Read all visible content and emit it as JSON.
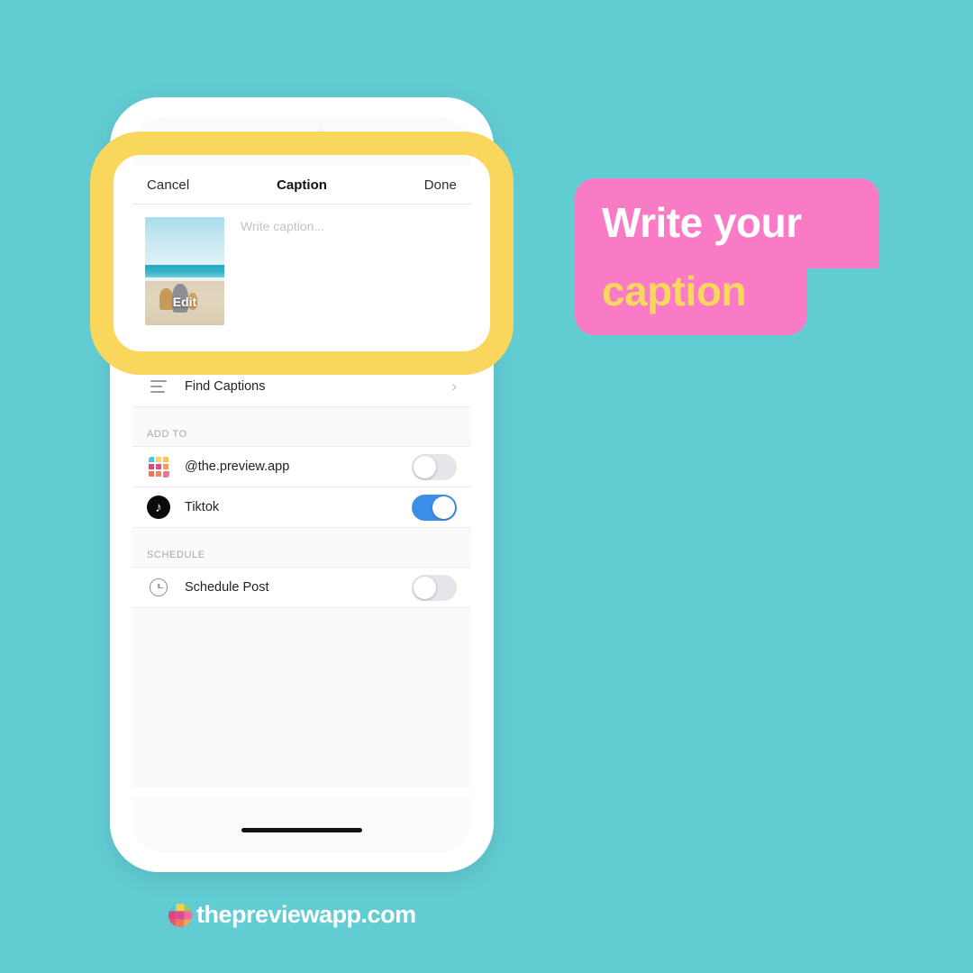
{
  "background_color": "#62ccd3",
  "highlight_color": "#f9d65c",
  "callout": {
    "bg_color": "#f97bc5",
    "line1": "Write your",
    "line1_color": "#ffffff",
    "line2": "caption",
    "line2_color": "#f9d65c"
  },
  "phone": {
    "navbar": {
      "cancel_label": "Cancel",
      "title": "Caption",
      "done_label": "Done"
    },
    "compose": {
      "thumbnail_overlay_label": "Edit",
      "caption_placeholder": "Write caption...",
      "caption_value": ""
    },
    "find_captions": {
      "icon": "text-lines-icon",
      "label": "Find Captions",
      "chevron": "›"
    },
    "add_to": {
      "section_label": "ADD TO",
      "items": [
        {
          "icon": "instagram-grid-icon",
          "label": "@the.preview.app",
          "toggle_state": "off",
          "toggle_color": "#e6e6ea"
        },
        {
          "icon": "tiktok-icon",
          "label": "Tiktok",
          "toggle_state": "on",
          "toggle_color": "#3c8fe8"
        }
      ]
    },
    "schedule": {
      "section_label": "SCHEDULE",
      "items": [
        {
          "icon": "clock-icon",
          "label": "Schedule Post",
          "toggle_state": "off",
          "toggle_color": "#e6e6ea"
        }
      ]
    }
  },
  "brand": {
    "logo": "preview-grid-logo",
    "text": "thepreviewapp.com"
  }
}
